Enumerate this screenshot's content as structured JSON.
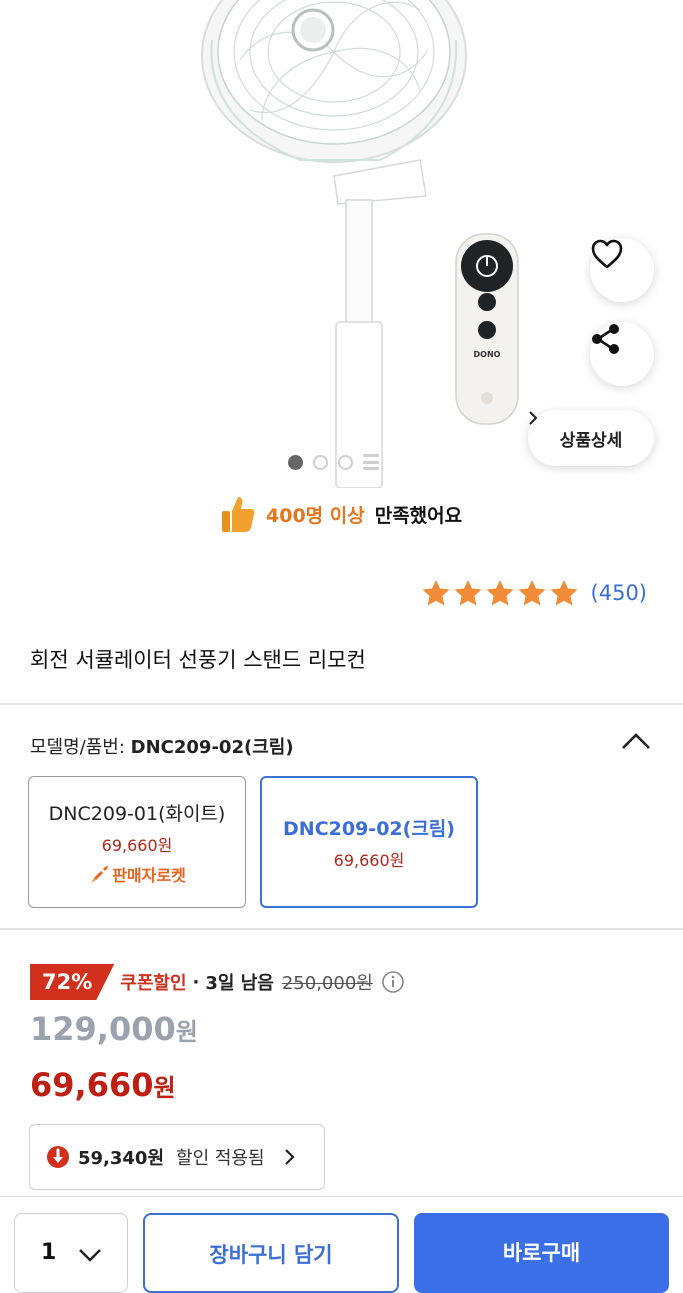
{
  "product_image": {
    "remote_brand": "DONO",
    "like_icon": "heart-icon",
    "share_icon": "share-icon",
    "detail_button_label": "상품상세",
    "carousel_total_dots": 3,
    "carousel_active_index": 0
  },
  "satisfaction": {
    "icon": "thumbs-up-icon",
    "highlight": "400명 이상",
    "text": "만족했어요"
  },
  "rating": {
    "stars": 5,
    "count": "(450)"
  },
  "product_title": "회전 서큘레이터 선풍기 스탠드 리모컨",
  "model_selector": {
    "label": "모델명/품번:",
    "selected": "DNC209-02(크림)",
    "options": [
      {
        "name": "DNC209-01(화이트)",
        "price": "69,660원",
        "badge": "판매자로켓"
      },
      {
        "name": "DNC209-02(크림)",
        "price": "69,660원"
      }
    ]
  },
  "pricing": {
    "discount_percent": "72%",
    "coupon_label": "쿠폰할인",
    "separator": "·",
    "remaining": "3일 남음",
    "original_price": "250,000원",
    "list_price": "129,000",
    "sale_price": "69,660",
    "currency": "원",
    "extra_discount_amount": "59,340원",
    "extra_discount_text": "할인 적용됨"
  },
  "bottom_bar": {
    "quantity": "1",
    "cart_button": "장바구니 담기",
    "buy_button": "바로구매"
  },
  "colors": {
    "accent_blue": "#3b6fd6",
    "sale_red": "#bf1e12",
    "badge_red": "#d0301c",
    "star_orange": "#f08c35",
    "highlight_orange": "#e6761b"
  }
}
